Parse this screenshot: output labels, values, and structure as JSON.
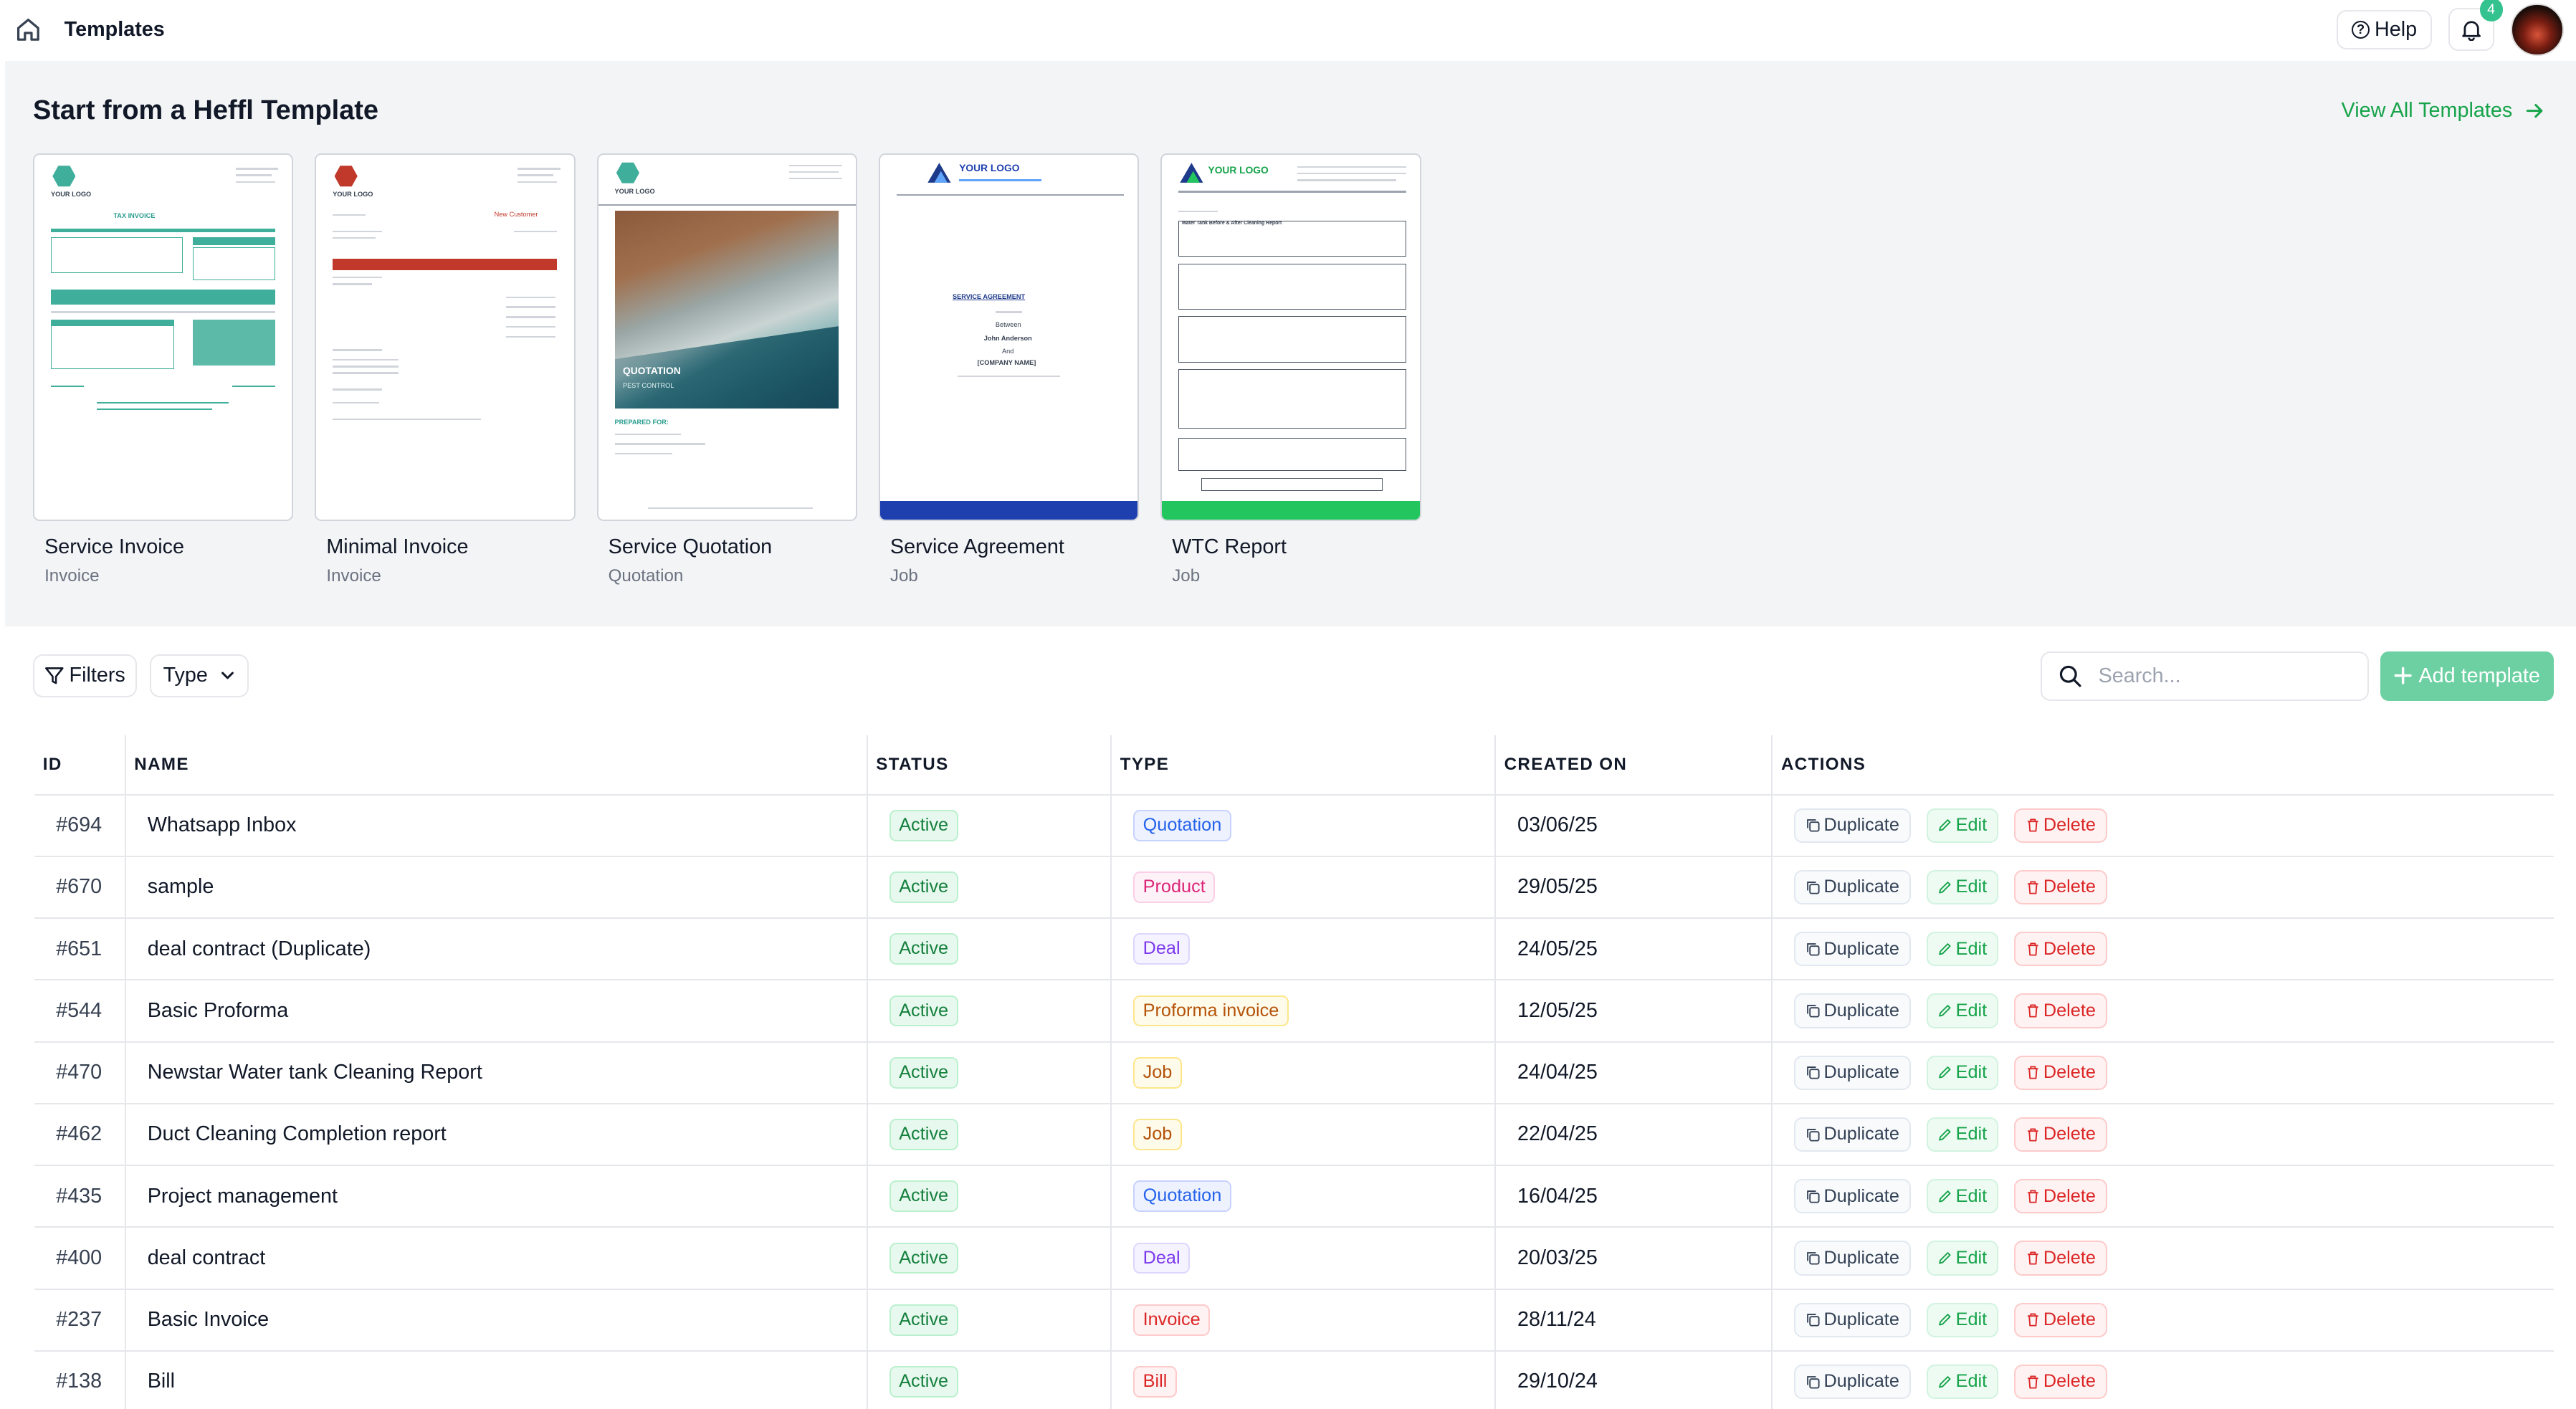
{
  "header": {
    "title": "Templates",
    "help_label": "Help",
    "notifications_count": "4"
  },
  "gallery": {
    "title": "Start from a Heffl Template",
    "view_all_label": "View All Templates",
    "cards": [
      {
        "name": "Service Invoice",
        "category": "Invoice"
      },
      {
        "name": "Minimal Invoice",
        "category": "Invoice"
      },
      {
        "name": "Service Quotation",
        "category": "Quotation"
      },
      {
        "name": "Service Agreement",
        "category": "Job"
      },
      {
        "name": "WTC Report",
        "category": "Job"
      }
    ],
    "thumb_text": {
      "your_logo": "YOUR LOGO",
      "tax_invoice": "TAX INVOICE",
      "new_customer": "New Customer",
      "quotation": "QUOTATION",
      "pest_control": "PEST CONTROL",
      "prepared_for": "PREPARED FOR:",
      "service_agreement": "SERVICE AGREEMENT",
      "between": "Between",
      "john": "John Anderson",
      "and": "And",
      "company": "[COMPANY NAME]",
      "wtc_heading": "Water Tank Before & After Cleaning Report"
    }
  },
  "toolbar": {
    "filters_label": "Filters",
    "type_label": "Type",
    "search_placeholder": "Search...",
    "add_label": "Add template"
  },
  "table": {
    "columns": [
      "ID",
      "NAME",
      "STATUS",
      "TYPE",
      "CREATED ON",
      "ACTIONS"
    ],
    "action_labels": {
      "duplicate": "Duplicate",
      "edit": "Edit",
      "delete": "Delete"
    },
    "rows": [
      {
        "id": "#694",
        "name": "Whatsapp Inbox",
        "status": "Active",
        "type": "Quotation",
        "created": "03/06/25"
      },
      {
        "id": "#670",
        "name": "sample",
        "status": "Active",
        "type": "Product",
        "created": "29/05/25"
      },
      {
        "id": "#651",
        "name": "deal contract (Duplicate)",
        "status": "Active",
        "type": "Deal",
        "created": "24/05/25"
      },
      {
        "id": "#544",
        "name": "Basic Proforma",
        "status": "Active",
        "type": "Proforma invoice",
        "created": "12/05/25"
      },
      {
        "id": "#470",
        "name": "Newstar Water tank Cleaning Report",
        "status": "Active",
        "type": "Job",
        "created": "24/04/25"
      },
      {
        "id": "#462",
        "name": "Duct Cleaning Completion report",
        "status": "Active",
        "type": "Job",
        "created": "22/04/25"
      },
      {
        "id": "#435",
        "name": "Project management",
        "status": "Active",
        "type": "Quotation",
        "created": "16/04/25"
      },
      {
        "id": "#400",
        "name": "deal contract",
        "status": "Active",
        "type": "Deal",
        "created": "20/03/25"
      },
      {
        "id": "#237",
        "name": "Basic Invoice",
        "status": "Active",
        "type": "Invoice",
        "created": "28/11/24"
      },
      {
        "id": "#138",
        "name": "Bill",
        "status": "Active",
        "type": "Bill",
        "created": "29/10/24"
      }
    ]
  },
  "type_colors": {
    "Quotation": {
      "bg": "#eef2ff",
      "fg": "#2563eb",
      "border": "#c7d2fe"
    },
    "Product": {
      "bg": "#fdf2f8",
      "fg": "#db2777",
      "border": "#fbcfe8"
    },
    "Deal": {
      "bg": "#f5f3ff",
      "fg": "#7c3aed",
      "border": "#ddd6fe"
    },
    "Proforma invoice": {
      "bg": "#fffbeb",
      "fg": "#b45309",
      "border": "#fde68a"
    },
    "Job": {
      "bg": "#fffbeb",
      "fg": "#b45309",
      "border": "#fde68a"
    },
    "Invoice": {
      "bg": "#fef2f2",
      "fg": "#dc2626",
      "border": "#fecaca"
    },
    "Bill": {
      "bg": "#fef2f2",
      "fg": "#dc2626",
      "border": "#fecaca"
    }
  },
  "colors": {
    "accent_green": "#16a34a",
    "add_button": "#6dd0a3",
    "section_bg": "#f3f4f6"
  }
}
